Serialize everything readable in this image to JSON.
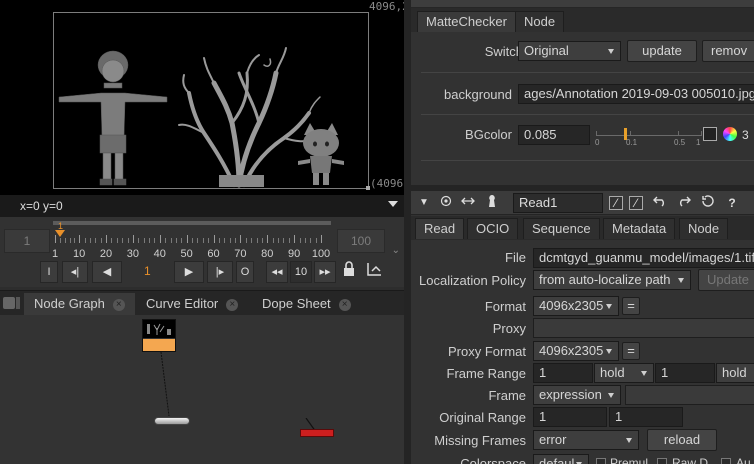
{
  "viewer": {
    "resolution_top": "4096,2",
    "resolution_bottom": "(4096,",
    "coords": "x=0 y=0"
  },
  "timeline": {
    "in_point": "1",
    "out_point": "100",
    "ticks": [
      "1",
      "10",
      "20",
      "30",
      "40",
      "50",
      "60",
      "70",
      "80",
      "90",
      "100"
    ],
    "current_marker": "1",
    "current_frame": "1",
    "step": "10",
    "transport": {
      "in": "I",
      "prev_key": "◂|",
      "play_back": "◀",
      "play_fwd": "▶",
      "next_key": "|▸",
      "out": "O",
      "back_inc": "◂◂",
      "fwd_inc": "▸▸"
    }
  },
  "node_graph": {
    "tabs": [
      {
        "label": "Node Graph",
        "active": true
      },
      {
        "label": "Curve Editor",
        "active": false
      },
      {
        "label": "Dope Sheet",
        "active": false
      }
    ]
  },
  "matte_panel": {
    "tabs": [
      {
        "label": "MatteChecker",
        "active": true
      },
      {
        "label": "Node",
        "active": false
      }
    ],
    "switch_label": "Switch",
    "switch_value": "Original",
    "update_label": "update",
    "remove_label": "remov",
    "background_label": "background",
    "background_value": "ages/Annotation 2019-09-03 005010.jpg",
    "bgcolor_label": "BGcolor",
    "bgcolor_value": "0.085",
    "slider_ticks": [
      "0",
      "0.1",
      "0.5",
      "1"
    ],
    "channels_label": "3"
  },
  "read_panel": {
    "node_name": "Read1",
    "tabs": [
      {
        "label": "Read",
        "active": true
      },
      {
        "label": "OCIO",
        "active": false
      },
      {
        "label": "Sequence",
        "active": false
      },
      {
        "label": "Metadata",
        "active": false
      },
      {
        "label": "Node",
        "active": false
      }
    ],
    "file_label": "File",
    "file_value": "dcmtgyd_guanmu_model/images/1.tif",
    "localization_label": "Localization Policy",
    "localization_value": "from auto-localize path",
    "update_label": "Update",
    "format_label": "Format",
    "format_value": "4096x2305",
    "proxy_label": "Proxy",
    "proxy_value": "",
    "proxy_format_label": "Proxy Format",
    "proxy_format_value": "4096x2305",
    "equals": "=",
    "frame_range_label": "Frame Range",
    "frame_range_start": "1",
    "frame_range_start_mode": "hold",
    "frame_range_end": "1",
    "frame_range_end_mode": "hold",
    "frame_label": "Frame",
    "frame_value": "expression",
    "original_range_label": "Original Range",
    "original_range_start": "1",
    "original_range_end": "1",
    "missing_frames_label": "Missing Frames",
    "missing_frames_value": "error",
    "reload_label": "reload",
    "colorspace_label": "Colorspace",
    "colorspace_value": "defaul",
    "premult_label": "Premul",
    "raw_label": "Raw D",
    "auto_label": "Au"
  },
  "colors": {
    "accent_orange": "#e8902a",
    "read_node": "#f4a750",
    "write_node": "#cc1f1f",
    "panel_bg": "#323232"
  }
}
